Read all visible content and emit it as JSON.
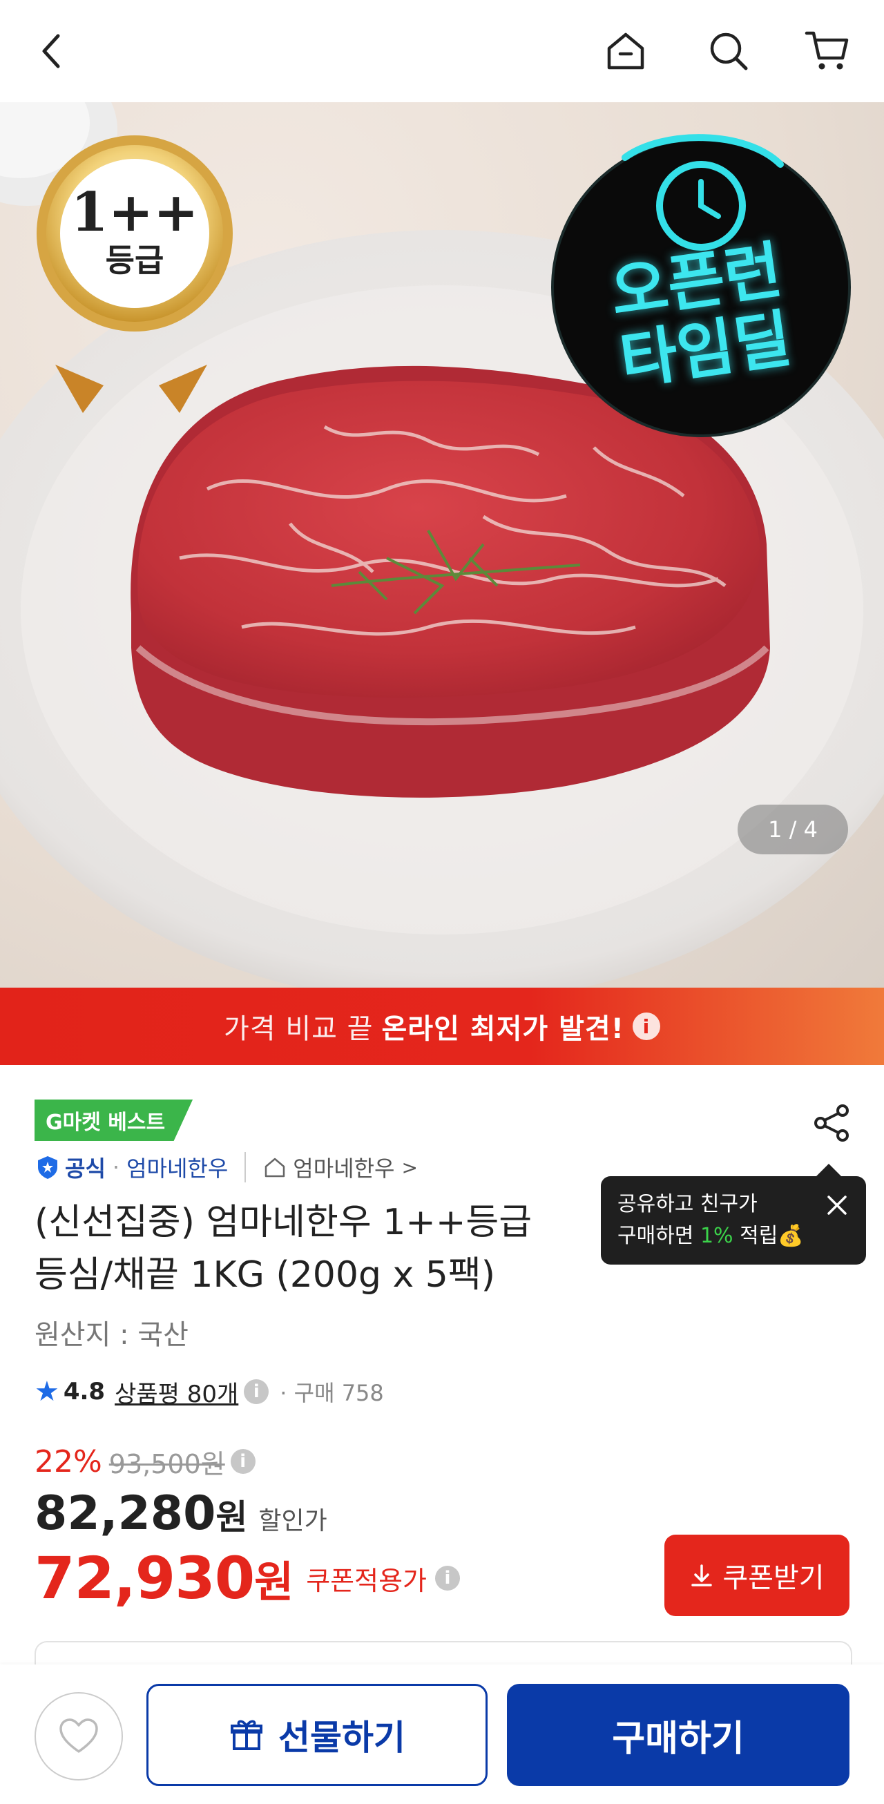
{
  "header": {
    "back_icon": "chevron-left-icon",
    "home_icon": "home-icon",
    "search_icon": "search-icon",
    "cart_icon": "cart-icon"
  },
  "hero": {
    "grade_badge_line1": "1++",
    "grade_badge_line2": "등급",
    "timedeal_line1": "오픈런",
    "timedeal_line2": "타임딜",
    "counter": "1 / 4"
  },
  "banner": {
    "prefix": "가격 비교 끝",
    "highlight": "온라인 최저가 발견!",
    "info": "i"
  },
  "product": {
    "best_badge": "G마켓 베스트",
    "official": "공식",
    "brand": "엄마네한우",
    "store": "엄마네한우",
    "store_arrow": ">",
    "title_line1": "(신선집중) 엄마네한우 1++등급",
    "title_line2": "등심/채끝 1KG (200g x 5팩)",
    "origin": "원산지 : 국산",
    "rating": "4.8",
    "reviews": "상품평 80개",
    "purchases": "· 구매 758"
  },
  "tooltip": {
    "line1": "공유하고 친구가",
    "line2_prefix": "구매하면",
    "line2_pct": "1%",
    "line2_suffix": "적립💰"
  },
  "price": {
    "discount_pct": "22%",
    "original": "93,500원",
    "sale": "82,280",
    "sale_unit": "원",
    "sale_label": "할인가",
    "coupon_price": "72,930",
    "coupon_unit": "원",
    "coupon_label": "쿠폰적용가",
    "coupon_button": "쿠폰받기"
  },
  "actions": {
    "gift": "선물하기",
    "buy": "구매하기"
  },
  "colors": {
    "accent_red": "#e4261c",
    "brand_blue": "#0a3aa8",
    "best_green": "#3bb54a"
  }
}
